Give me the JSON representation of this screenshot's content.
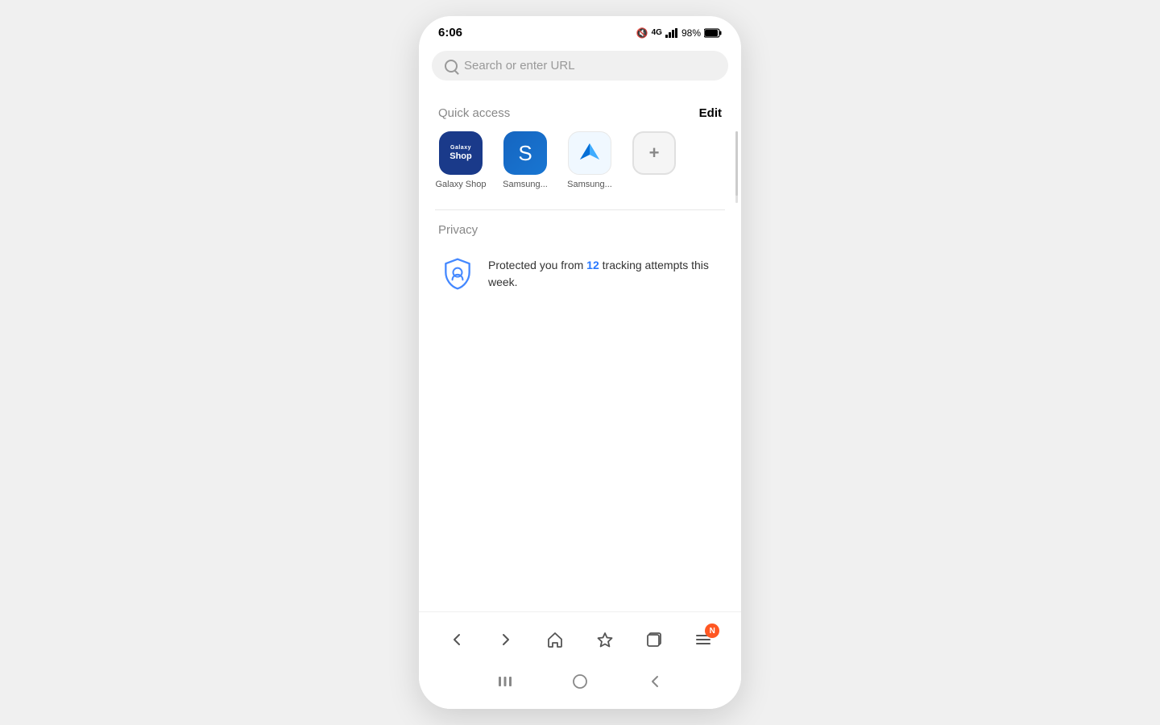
{
  "status_bar": {
    "time": "6:06",
    "battery": "98%",
    "signal_icon": "signal-icon",
    "wifi_icon": "wifi-icon",
    "mute_icon": "mute-icon"
  },
  "search": {
    "placeholder": "Search or enter URL"
  },
  "quick_access": {
    "section_label": "Quick access",
    "edit_label": "Edit",
    "items": [
      {
        "label": "Galaxy Shop",
        "icon_type": "galaxy-shop"
      },
      {
        "label": "Samsung...",
        "icon_type": "samsung-s"
      },
      {
        "label": "Samsung...",
        "icon_type": "samsung-arrow"
      },
      {
        "label": "",
        "icon_type": "add"
      }
    ]
  },
  "privacy": {
    "section_label": "Privacy",
    "message_part1": "Protected you from ",
    "tracking_count": "12",
    "message_part2": " tracking attempts this week."
  },
  "browser_nav": {
    "back_label": "back",
    "forward_label": "forward",
    "home_label": "home",
    "bookmark_label": "bookmark",
    "tabs_label": "tabs",
    "menu_label": "menu",
    "menu_badge": "N"
  },
  "system_nav": {
    "recent_label": "recent-apps",
    "home_label": "home",
    "back_label": "back"
  }
}
